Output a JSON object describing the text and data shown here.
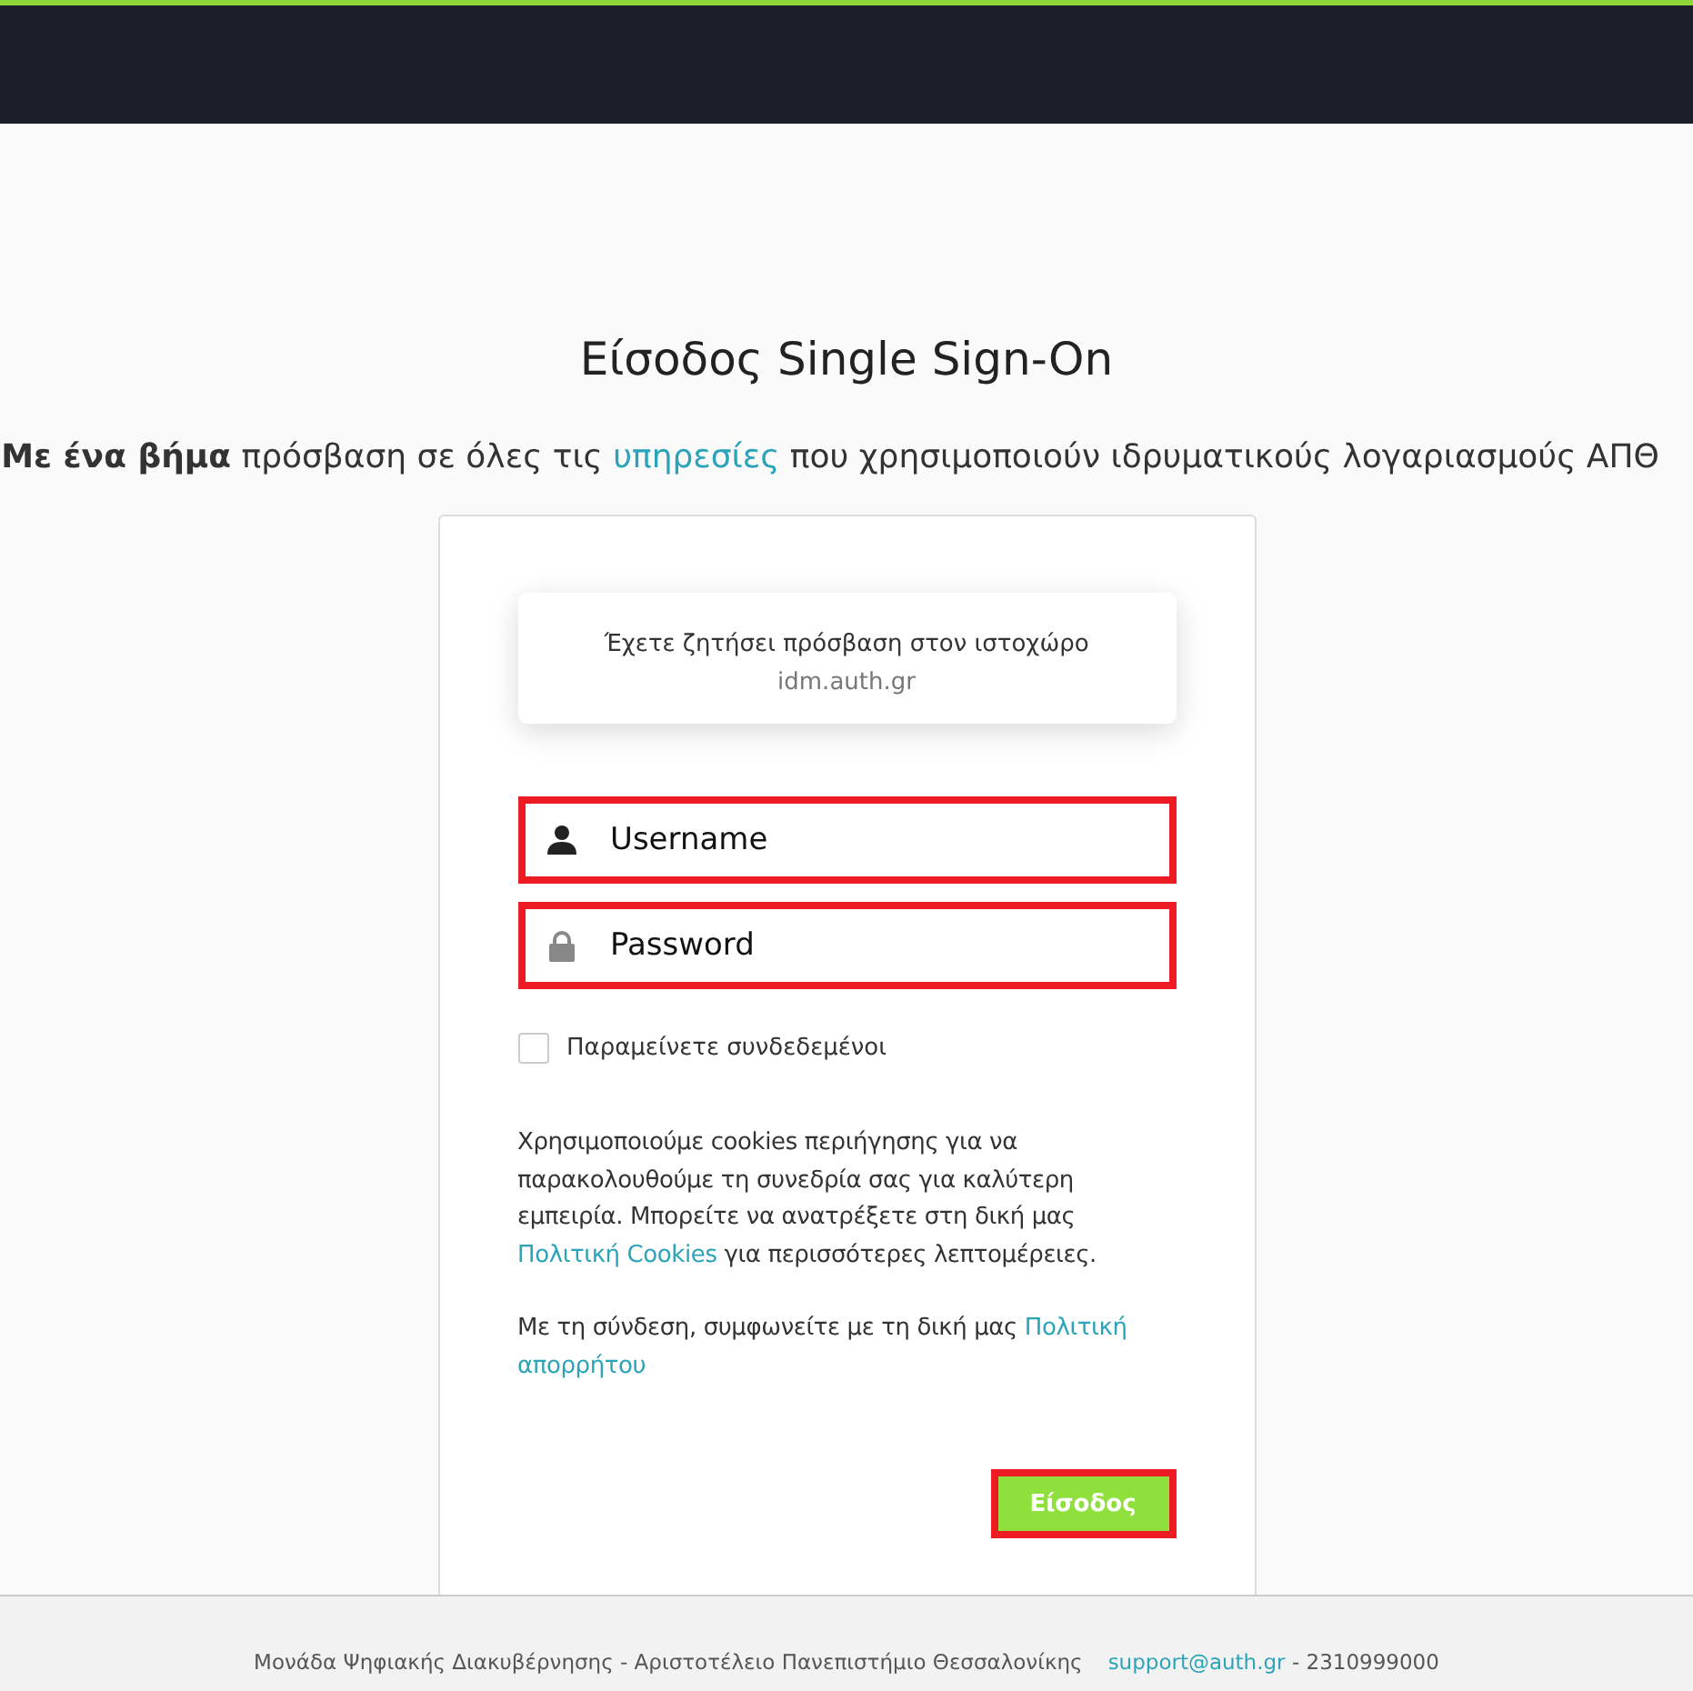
{
  "title": "Είσοδος Single Sign-On",
  "subtitle": {
    "bold": "Με ένα βήμα",
    "before": "πρόσβαση σε όλες τις",
    "link": "υπηρεσίες",
    "after": "που χρησιμοποιούν ιδρυματικούς λογαριασμούς ΑΠΘ"
  },
  "request": {
    "text": "Έχετε ζητήσει πρόσβαση στον ιστοχώρο",
    "site": "idm.auth.gr"
  },
  "fields": [
    {
      "kind": "user",
      "placeholder": "Username",
      "highlighted": true
    },
    {
      "kind": "password",
      "placeholder": "Password",
      "highlighted": true
    }
  ],
  "remember": {
    "label": "Παραμείνετε συνδεδεμένοι",
    "checked": false
  },
  "cookie_notice": {
    "before": "Χρησιμοποιούμε cookies περιήγησης για να παρακολουθούμε τη συνεδρία σας για καλύτερη εμπειρία. Μπορείτε να ανατρέξετε στη δική μας",
    "link": "Πολιτική Cookies",
    "after": "για περισσότερες λεπτομέρειες."
  },
  "privacy_notice": {
    "before": "Με τη σύνδεση, συμφωνείτε με τη δική μας",
    "link": "Πολιτική απορρήτου"
  },
  "login_button": {
    "label": "Είσοδος",
    "highlighted": true
  },
  "footer": {
    "org": "Μονάδα Ψηφιακής Διακυβέρνησης - Αριστοτέλειο Πανεπιστήμιο Θεσσαλονίκης",
    "email": "support@auth.gr",
    "phone": "- 2310999000"
  }
}
